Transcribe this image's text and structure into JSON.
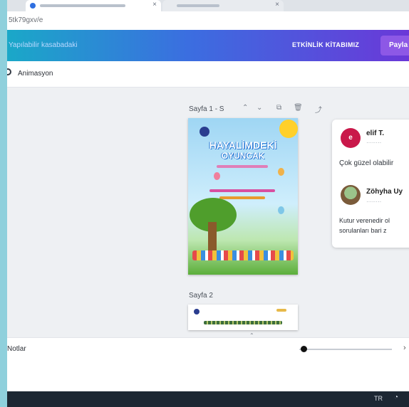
{
  "browser": {
    "url": "5tk79gxv/e"
  },
  "canva_header": {
    "doc_title": "Yapılabilir kasabadaki",
    "project_link": "ETKİNLİK KİTABIMIZ",
    "share_label": "Payla"
  },
  "toolbar": {
    "animation_label": "Animasyon"
  },
  "editor": {
    "page1_label": "Sayfa 1 - S",
    "page2_label": "Sayfa 2",
    "cover": {
      "title_line1": "HAYALİMDEKİ",
      "title_line2": "OYUNCAK"
    }
  },
  "comments": [
    {
      "initial": "e",
      "name": "elif T.",
      "text": "Çok güzel olabilir"
    },
    {
      "name": "Zöhyha Uy",
      "text_line1": "Kutur verenedir ol",
      "text_line2": "sorulanları bari z"
    }
  ],
  "bottom_bar": {
    "notes_label": "Notlar",
    "zoom_fraction": 0.05
  },
  "taskbar": {
    "lang": "TR"
  },
  "colors": {
    "header_gradient_start": "#1aa8c8",
    "header_gradient_end": "#6a38d8",
    "share_button": "#8d58e6",
    "comment_avatar": "#c9184a",
    "outer_frame": "#8fd0dc"
  }
}
